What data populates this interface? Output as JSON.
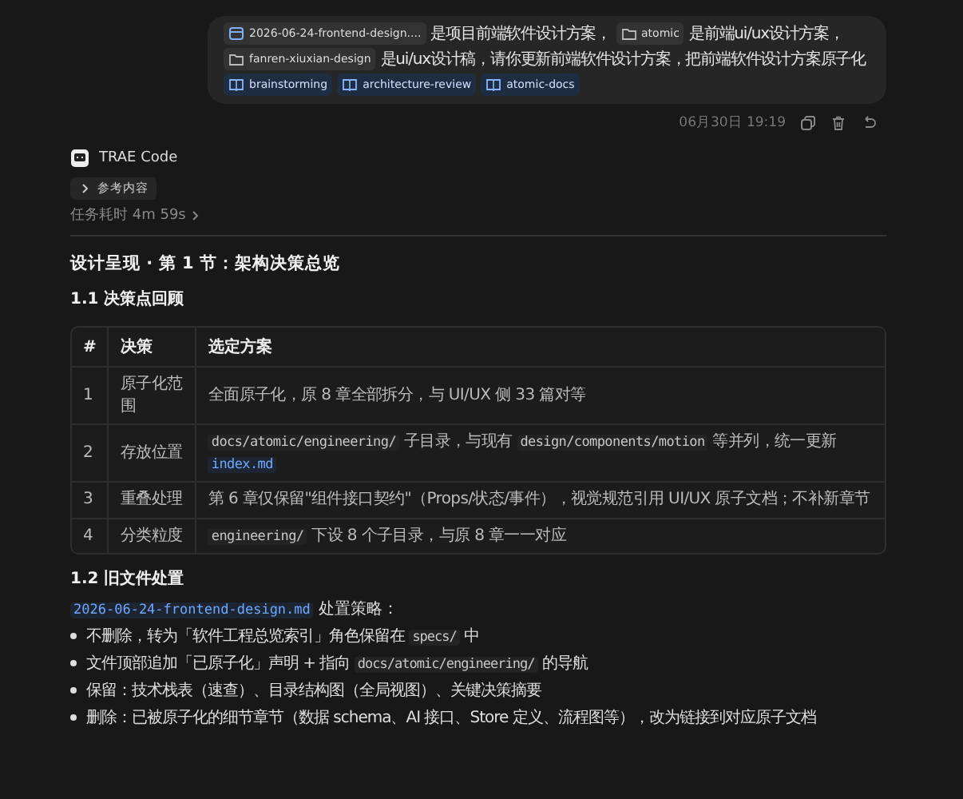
{
  "user_message": {
    "lines": [
      [
        {
          "kind": "file",
          "text": "2026-06-24-frontend-design...."
        },
        {
          "kind": "text",
          "text": "是项目前端软件设计方案，"
        },
        {
          "kind": "folder",
          "text": "atomic"
        },
        {
          "kind": "text",
          "text": "是前端ui/ux设计方案，"
        }
      ],
      [
        {
          "kind": "folder",
          "text": "fanren-xiuxian-design"
        },
        {
          "kind": "text",
          "text": "是ui/ux设计稿，请你更新前端软件设计方案，把前端软件设计方案原子化"
        }
      ],
      [
        {
          "kind": "skill",
          "text": "brainstorming"
        },
        {
          "kind": "skill",
          "text": "architecture-review"
        },
        {
          "kind": "skill",
          "text": "atomic-docs"
        }
      ]
    ],
    "time": "06月30日 19:19"
  },
  "assistant": {
    "name": "TRAE Code",
    "reference": {
      "label": "参考内容",
      "expanded": false
    },
    "duration": "任务耗时 4m 59s"
  },
  "content": {
    "title": "设计呈现 · 第 1 节：架构决策总览",
    "section_1": {
      "heading": "1.1 决策点回顾",
      "table": {
        "columns": [
          "#",
          "决策",
          "选定方案"
        ],
        "rows": [
          {
            "cells": [
              "1",
              "原子化范围",
              [
                {
                  "kind": "text",
                  "text": "全面原子化，原 8 章全部拆分，与 UI/UX 侧 33 篇对等"
                }
              ]
            ]
          },
          {
            "cells": [
              "2",
              "存放位置",
              [
                {
                  "kind": "code",
                  "text": "docs/atomic/engineering/"
                },
                {
                  "kind": "text",
                  "text": " 子目录，与现有 "
                },
                {
                  "kind": "code",
                  "text": "design/components/motion"
                },
                {
                  "kind": "text",
                  "text": " 等并列，统一更新 "
                },
                {
                  "kind": "ref",
                  "text": "index.md"
                }
              ]
            ]
          },
          {
            "cells": [
              "3",
              "重叠处理",
              [
                {
                  "kind": "text",
                  "text": "第 6 章仅保留\"组件接口契约\"（Props/状态/事件），视觉规范引用 UI/UX 原子文档；不补新章节"
                }
              ]
            ]
          },
          {
            "cells": [
              "4",
              "分类粒度",
              [
                {
                  "kind": "code",
                  "text": "engineering/"
                },
                {
                  "kind": "text",
                  "text": " 下设 8 个子目录，与原 8 章一一对应"
                }
              ]
            ]
          }
        ]
      }
    },
    "section_2": {
      "heading": "1.2 旧文件处置",
      "intro": [
        {
          "kind": "ref",
          "text": "2026-06-24-frontend-design.md"
        },
        {
          "kind": "text",
          "text": " 处置策略："
        }
      ],
      "bullets": [
        [
          {
            "kind": "text",
            "text": "不删除，转为「软件工程总览索引」角色保留在 "
          },
          {
            "kind": "code",
            "text": "specs/"
          },
          {
            "kind": "text",
            "text": " 中"
          }
        ],
        [
          {
            "kind": "text",
            "text": "文件顶部追加「已原子化」声明 + 指向 "
          },
          {
            "kind": "code",
            "text": "docs/atomic/engineering/"
          },
          {
            "kind": "text",
            "text": " 的导航"
          }
        ],
        [
          {
            "kind": "text",
            "text": "保留：技术栈表（速查）、目录结构图（全局视图）、关键决策摘要"
          }
        ],
        [
          {
            "kind": "text",
            "text": "删除：已被原子化的细节章节（数据 schema、AI 接口、Store 定义、流程图等），改为链接到对应原子文档"
          }
        ]
      ]
    }
  }
}
